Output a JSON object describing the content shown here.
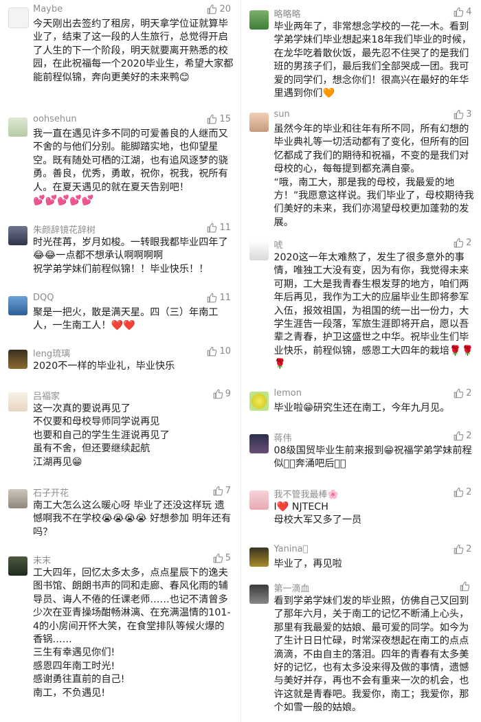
{
  "left": [
    {
      "name": "Maybe",
      "likes": "20",
      "text": "今天刚出去签约了租房，明天拿学位证就算毕业了，结束了这一段的人生旅行，总觉得开启了人生的下一个阶段，明天就要离开熟悉的校园，在此祝福每一个2020毕业生，希望大家都能前程似锦，奔向更美好的未来鸭😊"
    },
    {
      "name": "oohsehun",
      "likes": "15",
      "text": "我一直在遇见许多不同的可爱善良的人继而又不舍的与他们分别。能脚踏实地，也仰望星空。既有随处可栖的江湖，也有追风逐梦的骁勇。善良，优秀，勇敢，祝你，祝我，祝所有人。在夏天遇见的就在夏天告别吧！\n💕💕💕💕💕"
    },
    {
      "name": "朱颜辞镜花辞树",
      "likes": "11",
      "text": "时光荏苒，岁月如梭。一转眼我都毕业四年了😂😂一点都不想承认啊啊啊啊\n祝学弟学妹们前程似锦！！毕业快乐！！"
    },
    {
      "name": "DQQ",
      "likes": "11",
      "text": "聚是一把火，散是满天星。四（三）年南工人，一生南工人！❤️❤️"
    },
    {
      "name": "leng琉璃",
      "likes": "10",
      "text": "2020不一样的毕业礼，毕业快乐"
    },
    {
      "name": "吕福家",
      "likes": "9",
      "text": "这一次真的要说再见了\n不仅要和母校导师同学说再见\n也要和自己的学生生涯说再见了\n虽有不舍，但还要继续起航\n江湖再见😁"
    },
    {
      "name": "石子开花",
      "likes": "7",
      "text": "南工大怎么这么暖心呀 毕业了还没这样玩 遗憾啊我不在学校😭😭😭😭 好想参加 明年还有吗？"
    },
    {
      "name": "未末",
      "likes": "5",
      "text": "工大四年，回忆太多太多，点点星辰下的逸夫图书馆、朗朗书声的同和走廊、春风化雨的辅导员、诲人不倦的任课老师……也记不清曾多少次在亚青操场酣畅淋漓、在充满温情的101-4的小房间开怀大笑，在食堂排队等候火爆的香锅……\n三生有幸遇见你们!\n感恩四年南工时光!\n感谢勇往直前的自己!\n南工，不负遇见!"
    }
  ],
  "right": [
    {
      "name": "略略略",
      "likes": "4",
      "text": "毕业两年了，非常想念学校的一花一木。看到学弟学妹们毕业想起来18年我们毕业的时候，在龙华吃着散伙饭，最先忍不住哭了的是我们班的男孩子们，最后我们全部哭成一团。我可爱的同学们，想念你们！很高兴在最好的年华里遇到你们🧡"
    },
    {
      "name": "sun",
      "likes": "3",
      "text": "虽然今年的毕业和往年有所不同，所有幻想的毕业典礼等一切活动都有了变化，但所有的回忆都成了我们的期待和祝福，不变的是我们对母校的心，每每提到都充满自豪。\n“哦，南工大，那是我的母校，我最爱的地方！”我愿意这样说。我们毕业了，母校期待我们美好的未来，我们亦渴望母校更加蓬勃的发展。"
    },
    {
      "name": "唬",
      "likes": "2",
      "text": "2020这一年太难熬了，发生了很多意外的事情，唯独工大没有变，因为有你，我觉得未来可期，工大是我青春生根发芽的地方，咱们两年后再见，我作为工大的应届毕业生即将参军入伍，报效祖国，为祖国的统一出一份力，大学生涯告一段落，军旅生涯即将开启，愿以吾辈之青春，护卫这盛世之中华。祝毕业生们毕业快乐，前程似锦，感恩工大四年的栽培🌹🌹🌹"
    },
    {
      "name": "lemon",
      "likes": "2",
      "text": "毕业啦😁研究生还在南工，今年九月见。"
    },
    {
      "name": "蒋伟",
      "likes": "2",
      "text": "08级国贸毕业生前来报到😁祝福学弟学妹前程似锦🏻奔涌吧后浪🏻"
    },
    {
      "name": "我不管我最棒🌸",
      "likes": "2",
      "text": "I❤️ NJTECH\n母校大军又多了一员"
    },
    {
      "name": "Yanina🏻",
      "likes": "2",
      "text": "毕业了，再见啦"
    },
    {
      "name": "第一滴血",
      "likes": "",
      "text": "看到学弟学妹们发的毕业照，仿佛自己又回到了那年六月，关于南工的记忆不断涌上心头，那里有我最爱的姑娘、最可爱的同学。如今为了生计日日忙碌，时常深夜想起在南工的点点滴滴，不由自主的落泪。四年的青春有太多美好的记忆，也有太多没来得及做的事情，遗憾与美好并存，再也不会有重来一次的机会，也许这就是青春吧。我爱你，南工；我爱你，那个如雪一般的姑娘。"
    }
  ],
  "icons": {
    "like": "thumbs-up-icon"
  },
  "colors": {
    "name": "#8c8c8c",
    "text": "#202020",
    "like": "#888888",
    "background": "#ffffff"
  }
}
